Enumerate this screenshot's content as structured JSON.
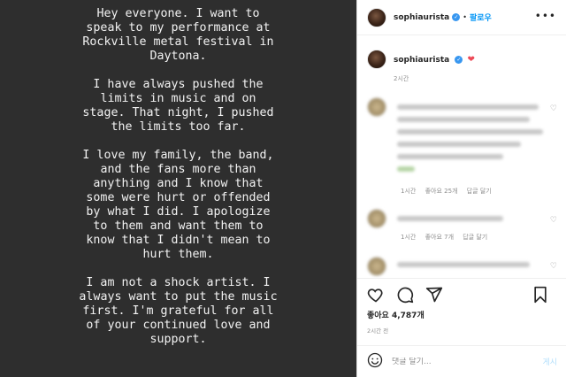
{
  "story": {
    "paragraphs": [
      "Hey everyone. I want to\nspeak to my performance at\nRockville metal festival in\nDaytona.",
      "I have always pushed the\nlimits in music and on\nstage. That night, I pushed\nthe limits too far.",
      "I love my family, the band,\nand the fans more than\nanything and I know that\nsome were hurt or offended\nby what I did. I apologize\nto them and want them to\nknow that I didn't mean to\nhurt them.",
      "I am not a shock artist. I\nalways want to put the music\nfirst. I'm grateful for all\nof your continued love and\nsupport."
    ]
  },
  "header": {
    "username": "sophiaurista",
    "separator": "•",
    "follow_label": "팔로우",
    "more_label": "•••"
  },
  "caption": {
    "username": "sophiaurista",
    "emoji": "❤",
    "time": "2시간"
  },
  "comments": [
    {
      "time": "1시간",
      "likes": "좋아요 25개",
      "reply": "답글 달기"
    },
    {
      "time": "1시간",
      "likes": "좋아요 7개",
      "reply": "답글 달기"
    }
  ],
  "likes_text": "좋아요 4,787개",
  "post_time": "2시간 전",
  "add_comment": {
    "placeholder": "댓글 달기...",
    "post_label": "게시"
  },
  "colors": {
    "story_bg": "#2e2e2e",
    "accent": "#0095f6",
    "heart": "#ed4956"
  },
  "icons": [
    "heart-icon",
    "comment-icon",
    "share-icon",
    "bookmark-icon",
    "emoji-icon",
    "verified-badge-icon"
  ]
}
